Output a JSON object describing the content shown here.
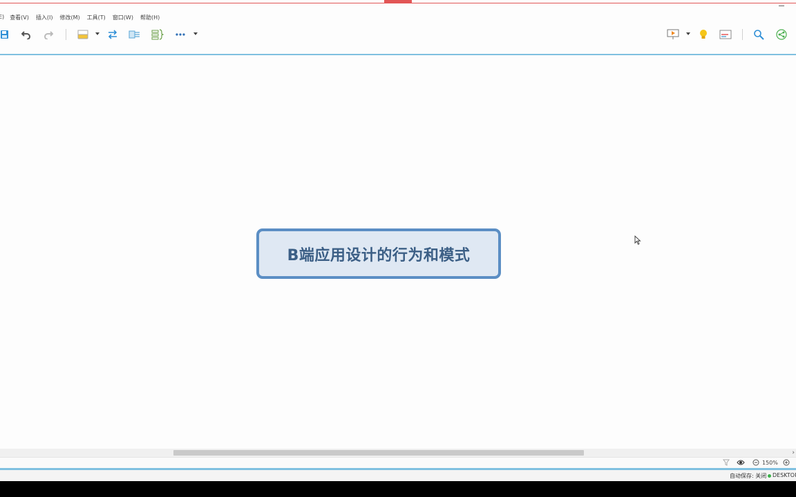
{
  "menu": {
    "items": [
      "E)",
      "查看(V)",
      "插入(I)",
      "修改(M)",
      "工具(T)",
      "窗口(W)",
      "帮助(H)"
    ]
  },
  "toolbar": {
    "icons": [
      "save-icon",
      "undo-icon",
      "redo-icon",
      "topic-style-icon",
      "relationship-icon",
      "boundary-icon",
      "summary-icon",
      "more-icon",
      "presentation-icon",
      "idea-icon",
      "layout-icon",
      "search-icon",
      "share-icon"
    ]
  },
  "canvas": {
    "central_topic": "B端应用设计的行为和模式"
  },
  "zoom": {
    "value": "150%"
  },
  "status": {
    "autosave": "自动保存: 关闭",
    "computer": "DESKTOP"
  },
  "colors": {
    "accent": "#7fc0e0",
    "topic_border": "#5b8ec4",
    "topic_fill": "#dfe8f3",
    "topic_text": "#3c5f86",
    "top_bar": "#e25555"
  }
}
